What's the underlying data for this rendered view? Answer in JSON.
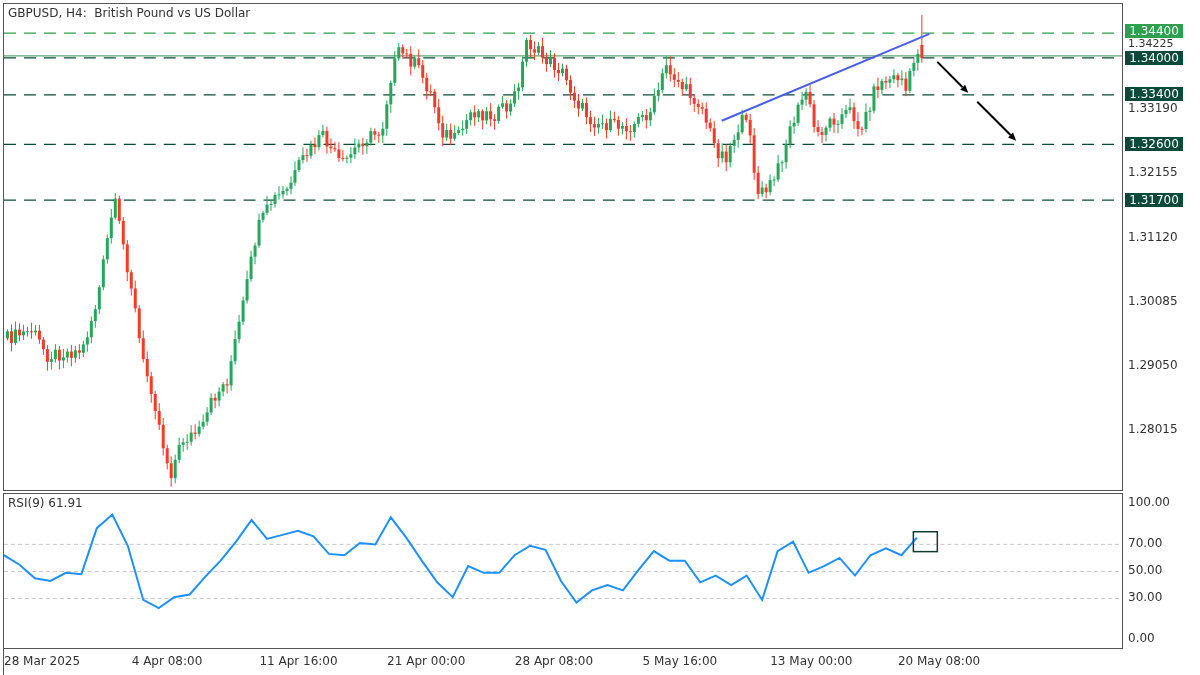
{
  "chart_title": "GBPUSD, H4:  British Pound vs US Dollar",
  "price_axis": {
    "ticks": [
      "1.34225",
      "1.33190",
      "1.32155",
      "1.31120",
      "1.30085",
      "1.29050",
      "1.28015"
    ]
  },
  "levels": [
    {
      "label": "1.34400",
      "color": "#2e9e4f"
    },
    {
      "label": "1.34000",
      "color": "#0b4a3a"
    },
    {
      "label": "1.33400",
      "color": "#0b4a3a"
    },
    {
      "label": "1.32600",
      "color": "#0b4a3a"
    },
    {
      "label": "1.31700",
      "color": "#0b4a3a"
    }
  ],
  "rsi": {
    "chart_data": {
      "type": "line",
      "title": "RSI(9) 61.91",
      "ylim": [
        -6.5,
        107.2
      ],
      "grid": true,
      "yticks": [
        {
          "value": 100,
          "label": "100.00"
        },
        {
          "value": 70,
          "label": "70.00"
        },
        {
          "value": 50,
          "label": "50.00"
        },
        {
          "value": 30,
          "label": "30.00"
        },
        {
          "value": 0,
          "label": "0.00"
        }
      ],
      "series": [
        {
          "color": "#1e90ff",
          "values": [
            62,
            55,
            45,
            43,
            49,
            48,
            82,
            92,
            69,
            29,
            23,
            31,
            33,
            46,
            58,
            72,
            88,
            74,
            77,
            80,
            76,
            63,
            62,
            71,
            70,
            90,
            75,
            58,
            42,
            31,
            54,
            49,
            49,
            62,
            69,
            66,
            43,
            27,
            36,
            40,
            36,
            51,
            65,
            58,
            58,
            42,
            47,
            40,
            47,
            29,
            65,
            72,
            49,
            54,
            60,
            47,
            62,
            67,
            62,
            75
          ]
        }
      ]
    }
  },
  "time_axis": [
    "28 Mar 2025",
    "4 Apr 08:00",
    "11 Apr 16:00",
    "21 Apr 00:00",
    "28 Apr 08:00",
    "5 May 16:00",
    "13 May 00:00",
    "20 May 08:00"
  ]
}
